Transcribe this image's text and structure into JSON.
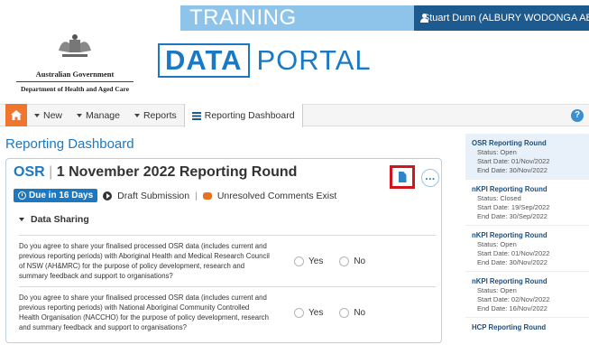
{
  "banner": {
    "environment": "TRAINING ENVIRONMENT",
    "user": "Stuart Dunn (ALBURY WODONGA ABORIGINAL"
  },
  "gov_logo": {
    "name": "Australian Government",
    "department": "Department of Health and Aged Care"
  },
  "portal_logo": {
    "bold": "DATA",
    "light": "PORTAL"
  },
  "nav": {
    "items": [
      {
        "label": "New",
        "caret": true
      },
      {
        "label": "Manage",
        "caret": true
      },
      {
        "label": "Reports",
        "caret": true
      }
    ],
    "active_tab": "Reporting Dashboard",
    "help": "?"
  },
  "page": {
    "title": "Reporting Dashboard"
  },
  "round": {
    "abbr": "OSR",
    "separator": "|",
    "title": "1 November 2022 Reporting Round",
    "more": "...",
    "due": "Due in 16 Days",
    "status": "Draft Submission",
    "divider": "|",
    "comments": "Unresolved Comments Exist",
    "section": "Data Sharing",
    "questions": [
      {
        "text": "Do you agree to share your finalised processed OSR data (includes current and previous reporting periods) with Aboriginal Health and Medical Research Council of NSW (AH&MRC) for the purpose of policy development, research and summary feedback and support to organisations?",
        "yes": "Yes",
        "no": "No"
      },
      {
        "text": "Do you agree to share your finalised processed OSR data (includes current and previous reporting periods) with National Aboriginal Community Controlled Health Organisation (NACCHO) for the purpose of policy development, research and summary feedback and support to organisations?",
        "yes": "Yes",
        "no": "No"
      }
    ]
  },
  "sidebar": {
    "rounds": [
      {
        "name": "OSR Reporting Round",
        "status": "Status: Open",
        "start": "Start Date: 01/Nov/2022",
        "end": "End Date: 30/Nov/2022"
      },
      {
        "name": "nKPI Reporting Round",
        "status": "Status: Closed",
        "start": "Start Date: 19/Sep/2022",
        "end": "End Date: 30/Sep/2022"
      },
      {
        "name": "nKPI Reporting Round",
        "status": "Status: Open",
        "start": "Start Date: 01/Nov/2022",
        "end": "End Date: 30/Nov/2022"
      },
      {
        "name": "nKPI Reporting Round",
        "status": "Status: Open",
        "start": "Start Date: 02/Nov/2022",
        "end": "End Date: 16/Nov/2022"
      },
      {
        "name": "HCP Reporting Round",
        "status": "",
        "start": "",
        "end": ""
      }
    ]
  },
  "colors": {
    "brand_blue": "#1b79c4",
    "home_orange": "#f0762d",
    "highlight_red": "#d0151d",
    "env_blue": "#8fc4ea",
    "user_navy": "#1d5a8f"
  }
}
